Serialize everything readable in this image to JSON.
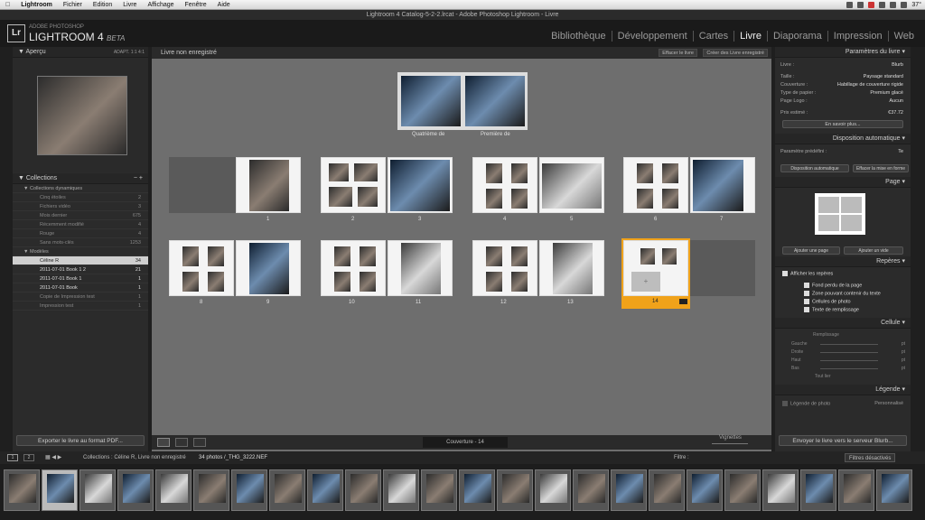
{
  "menubar": {
    "apple": "",
    "app": "Lightroom",
    "items": [
      "Fichier",
      "Edition",
      "Livre",
      "Affichage",
      "Fenêtre",
      "Aide"
    ],
    "temp": "37°"
  },
  "window_title": "Lightroom 4 Catalog-5-2-2.lrcat - Adobe Photoshop Lightroom - Livre",
  "brand": {
    "logo": "Lr",
    "line1": "ADOBE PHOTOSHOP",
    "line2": "LIGHTROOM 4",
    "beta": "BETA"
  },
  "modules": [
    "Bibliothèque",
    "Développement",
    "Cartes",
    "Livre",
    "Diaporama",
    "Impression",
    "Web"
  ],
  "active_module": "Livre",
  "left": {
    "preview_title": "Aperçu",
    "preview_opts": "ADAPT.  1:1  4:1",
    "collections_title": "Collections",
    "rows": [
      {
        "label": "Collections dynamiques",
        "count": ""
      },
      {
        "label": "Cinq étoiles",
        "count": "2"
      },
      {
        "label": "Fichiers vidéo",
        "count": "3"
      },
      {
        "label": "Mois dernier",
        "count": "675"
      },
      {
        "label": "Récemment modifié",
        "count": "4"
      },
      {
        "label": "Rouge",
        "count": "4"
      },
      {
        "label": "Sans mots-clés",
        "count": "1253"
      },
      {
        "label": "Modèles",
        "count": ""
      },
      {
        "label": "Céline R",
        "count": "34"
      },
      {
        "label": "2011-07-01 Book 1 2",
        "count": "21"
      },
      {
        "label": "2011-07-01 Book 1",
        "count": "1"
      },
      {
        "label": "2011-07-01 Book",
        "count": "1"
      },
      {
        "label": "Copie de Impression test",
        "count": "1"
      },
      {
        "label": "Impression test",
        "count": "1"
      }
    ],
    "export_label": "Exporter le livre au format PDF..."
  },
  "center": {
    "title": "Livre non enregistré",
    "btn_clear": "Effacer le livre",
    "btn_create": "Créer des Livre enregistré",
    "cover_labels": [
      "Quatrième de",
      "Première de"
    ],
    "page_numbers": [
      "1",
      "2",
      "3",
      "4",
      "5",
      "6",
      "7",
      "8",
      "9",
      "10",
      "11",
      "12",
      "13",
      "14"
    ],
    "pager": "Couverture - 14",
    "thumb_label": "Vignettes"
  },
  "right": {
    "book_settings_title": "Paramètres du livre",
    "book_label": "Livre :",
    "book_value": "Blurb",
    "size_label": "Taille :",
    "size_value": "Paysage standard",
    "cover_label": "Couverture :",
    "cover_value": "Habillage de couverture rigide",
    "paper_label": "Type de papier :",
    "paper_value": "Premium glacé",
    "logo_label": "Page Logo :",
    "logo_value": "Aucun",
    "price_label": "Prix estimé :",
    "price_value": "€37.72",
    "more_btn": "En savoir plus...",
    "auto_title": "Disposition automatique",
    "preset_label": "Paramètre prédéfini :",
    "preset_value": "Te",
    "auto_btn": "Disposition automatique",
    "clear_layout_btn": "Effacer la mise en forme",
    "page_title": "Page",
    "add_page": "Ajouter une page",
    "add_blank": "Ajouter un vide",
    "guides_title": "Repères",
    "show_guides": "Afficher les repères",
    "guides": [
      "Fond perdu de la page",
      "Zone pouvant contenir du texte",
      "Cellules de photo",
      "Texte de remplissage"
    ],
    "cell_title": "Cellule",
    "padding": "Remplissage",
    "sides": [
      "Gauche",
      "Droite",
      "Haut",
      "Bas"
    ],
    "unit": "pt",
    "link_all": "Tout lier",
    "legend_title": "Légende",
    "photo_caption": "Légende de photo",
    "caption_opt": "Personnalisé",
    "send_btn": "Envoyer le livre vers le serveur Blurb..."
  },
  "filmbar": {
    "path": "Collections : Céline R, Livre non enregistré",
    "count": "34 photos /_THG_3222.NEF",
    "filter_label": "Filtre :",
    "filter_value": "Filtres désactivés"
  }
}
